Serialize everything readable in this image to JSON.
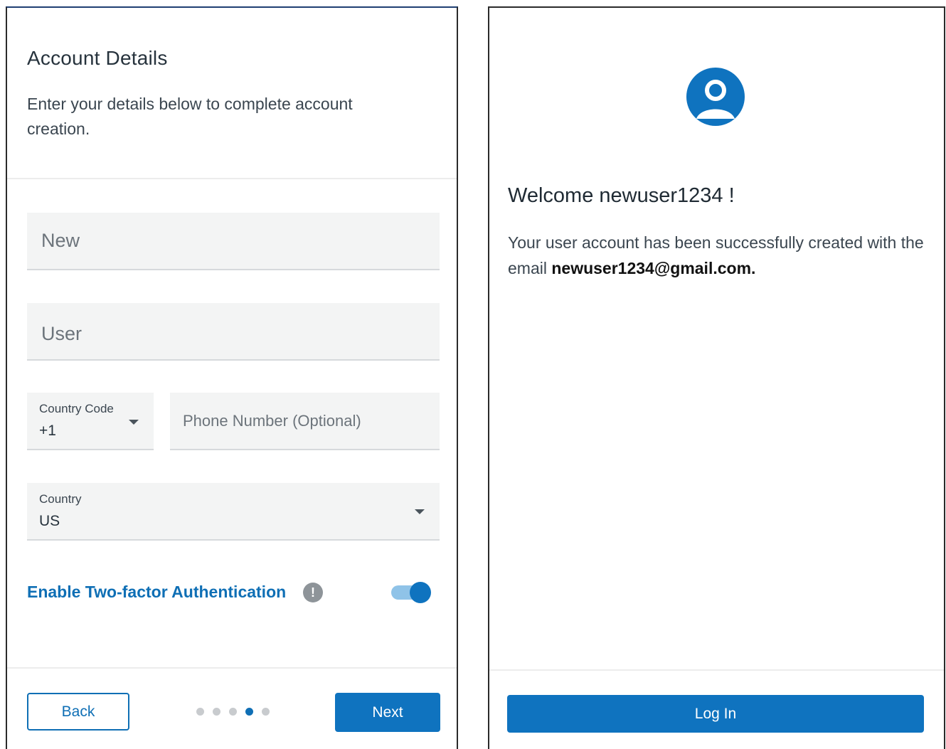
{
  "account_details": {
    "title": "Account Details",
    "subtitle": "Enter your details below to complete account creation.",
    "first_name_value": "New",
    "last_name_value": "User",
    "country_code": {
      "label": "Country Code",
      "value": "+1"
    },
    "phone": {
      "placeholder": "Phone Number (Optional)"
    },
    "country": {
      "label": "Country",
      "value": "US"
    },
    "two_factor": {
      "label": "Enable Two-factor Authentication",
      "info_glyph": "!",
      "enabled": true
    },
    "back_label": "Back",
    "next_label": "Next",
    "pagination": {
      "total": 5,
      "active_index": 3
    }
  },
  "welcome": {
    "greeting": "Welcome",
    "username": "newuser1234",
    "exclaim": "!",
    "message_prefix": "Your user account has been successfully created with the email",
    "email": "newuser1234@gmail.com.",
    "login_label": "Log In"
  },
  "colors": {
    "accent": "#0f73bf",
    "field_bg": "#f3f4f4",
    "toggle_track": "#8fc3e8",
    "dot_inactive": "#c8cbce"
  },
  "icons": {
    "dropdown": "chevron-down-icon",
    "info": "info-icon",
    "avatar": "user-avatar-icon"
  }
}
